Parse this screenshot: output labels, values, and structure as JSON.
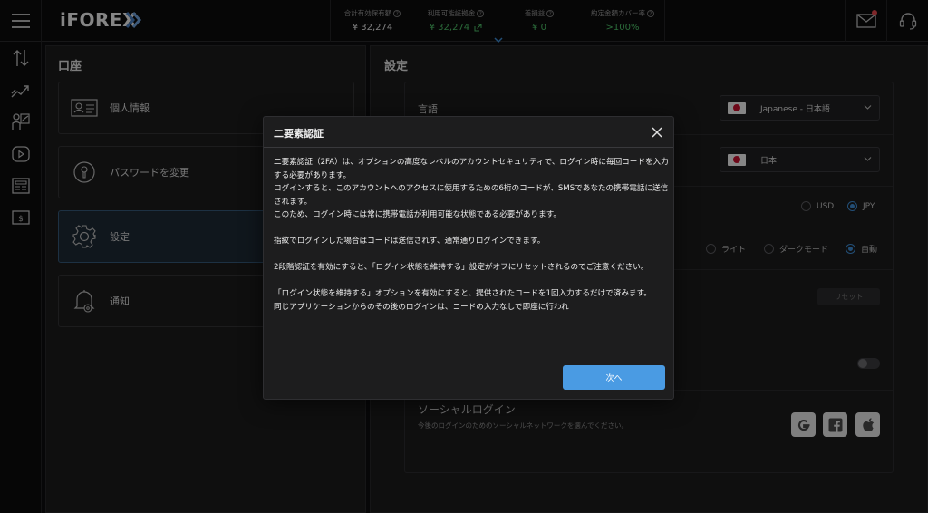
{
  "header": {
    "logo_text": "iFOREX",
    "stats": [
      {
        "label": "合計有効保有額",
        "value": "¥ 32,274",
        "value_color": "#e8e8e8"
      },
      {
        "label": "利用可能証拠金",
        "value": "¥ 32,274",
        "value_color": "#4fc36a"
      },
      {
        "label": "差損益",
        "value": "¥ 0",
        "value_color": "#4fc36a"
      },
      {
        "label": "約定金額カバー率",
        "value": ">100%",
        "value_color": "#4fc36a"
      }
    ],
    "help_glyph": "?"
  },
  "rail": {
    "icons": [
      "transfer-arrows-icon",
      "chart-trend-icon",
      "trader-chart-icon",
      "video-play-icon",
      "news-icon",
      "dollar-bill-icon"
    ]
  },
  "account": {
    "title": "口座",
    "items": [
      {
        "label": "個人情報",
        "icon": "id-card-icon"
      },
      {
        "label": "パスワードを変更",
        "icon": "keyhole-icon"
      },
      {
        "label": "設定",
        "icon": "gear-icon"
      },
      {
        "label": "通知",
        "icon": "bell-icon"
      }
    ]
  },
  "settings": {
    "title": "設定",
    "language_label": "言語",
    "language_value": "Japanese - 日本語",
    "country_value": "日本",
    "currency_options": [
      "USD",
      "JPY"
    ],
    "currency_selected": "JPY",
    "theme_options": [
      "ライト",
      "ダークモード",
      "自動"
    ],
    "theme_selected": "自動",
    "reset_label": "リセット",
    "social_title": "ソーシャルログイン",
    "social_desc": "今後のログインのためのソーシャルネットワークを選んでください。",
    "social_icons": [
      "google-icon",
      "facebook-icon",
      "apple-icon"
    ]
  },
  "modal": {
    "title": "二要素認証",
    "paragraphs": [
      "二要素認証（2FA）は、オプションの高度なレベルのアカウントセキュリティで、ログイン時に毎回コードを入力する必要があります。",
      "ログインすると、このアカウントへのアクセスに使用するための6桁のコードが、SMSであなたの携帯電話に送信されます。",
      "このため、ログイン時には常に携帯電話が利用可能な状態である必要があります。",
      "",
      "指紋でログインした場合はコードは送信されず、通常通りログインできます。",
      "",
      "2段階認証を有効にすると、「ログイン状態を維持する」設定がオフにリセットされるのでご注意ください。",
      "",
      "「ログイン状態を維持する」オプションを有効にすると、提供されたコードを1回入力するだけで済みます。",
      "同じアプリケーションからのその後のログインは、コードの入力なしで即座に行われ"
    ],
    "next_label": "次へ"
  },
  "colors": {
    "accent": "#4a9be3",
    "positive": "#4fc36a",
    "notification": "#e5484d"
  }
}
